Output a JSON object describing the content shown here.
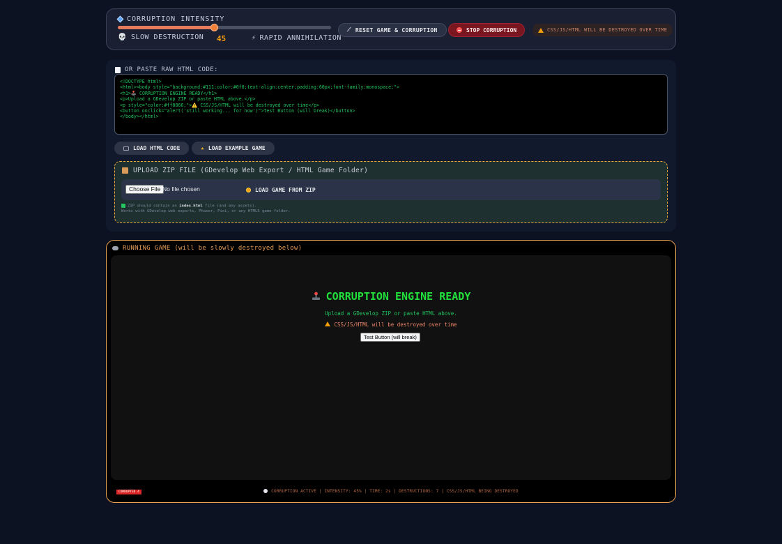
{
  "controls": {
    "intensity_label": "CORRUPTION INTENSITY",
    "intensity_value": "45",
    "intensity_fraction": 0.45,
    "slow_label": "SLOW DESTRUCTION",
    "rapid_label": "RAPID ANNIHILATION",
    "reset_label": "RESET GAME & CORRUPTION",
    "stop_label": "STOP CORRUPTION",
    "warning_text": "CSS/JS/HTML WILL BE DESTROYED OVER TIME"
  },
  "input": {
    "paste_label": "OR PASTE RAW HTML CODE:",
    "code": "<!DOCTYPE html>\n<html><body style=\"background:#111;color:#0f0;text-align:center;padding:60px;font-family:monospace;\">\n<h1>🕹️ CORRUPTION ENGINE READY</h1>\n<p>Upload a GDevelop ZIP or paste HTML above.</p>\n<p style=\"color:#ff8866;\">⚠️ CSS/JS/HTML will be destroyed over time</p>\n<button onclick=\"alert('still working... for now')\">Test Button (will break)</button>\n</body></html>",
    "load_html_label": "LOAD HTML CODE",
    "load_example_label": "LOAD EXAMPLE GAME"
  },
  "zip": {
    "title": "UPLOAD ZIP FILE (GDevelop Web Export / HTML Game Folder)",
    "choose_file_label": "Choose File",
    "file_status": "No file chosen",
    "load_zip_label": "LOAD GAME FROM ZIP",
    "help_line1_pre": "ZIP should contain an ",
    "help_line1_bold": "index.html",
    "help_line1_post": " file (and any assets).",
    "help_line2": "Works with GDevelop web exports, Phaser, Pixi, or any HTML5 game folder."
  },
  "game": {
    "header": "RUNNING GAME (will be slowly destroyed below)",
    "title": "CORRUPTION ENGINE READY",
    "subtitle": "Upload a GDevelop ZIP or paste HTML above.",
    "warning": "CSS/JS/HTML will be destroyed over time",
    "test_button_label": "Test Button (will break)",
    "corrupted_tag": "CORRUPTED 4",
    "status": "CORRUPTION ACTIVE | INTENSITY: 45% | TIME: 2s | DESTRUCTIONS: 7 | CSS/JS/HTML BEING DESTROYED"
  },
  "colors": {
    "accent_orange": "#e9a252",
    "code_green": "#22c55e",
    "stop_red": "#7a1620"
  }
}
